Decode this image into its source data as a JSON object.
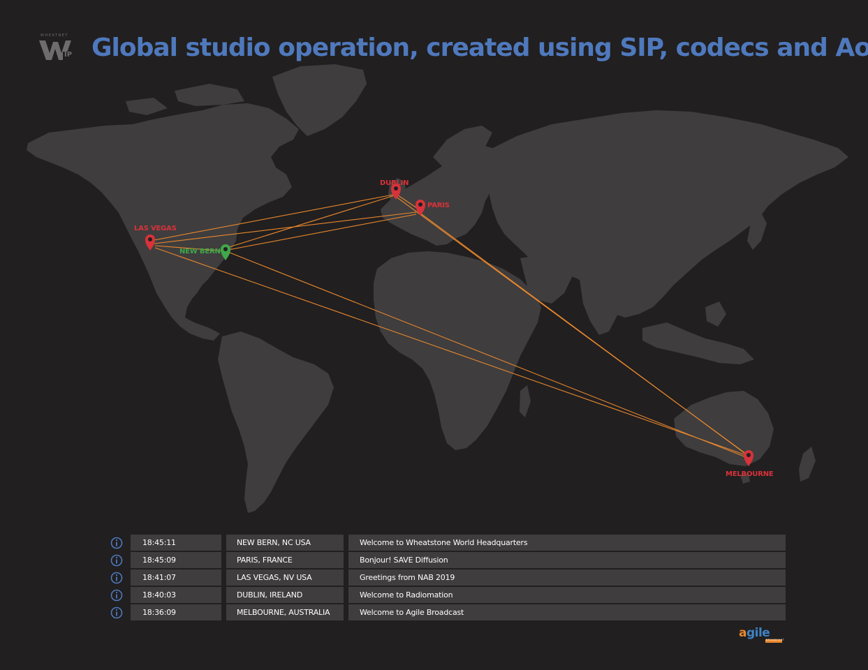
{
  "header": {
    "title": "Global studio operation, created using SIP, codecs and AoIP",
    "logo_small_text": "WHEATNET",
    "logo_text": "W",
    "logo_badge": "IP"
  },
  "map": {
    "line_color": "#e9882d",
    "land_color": "#3f3d3e",
    "ocean_color": "#211f20",
    "cities": [
      {
        "id": "dublin",
        "label": "DUBLIN",
        "color": "#d8323a"
      },
      {
        "id": "paris",
        "label": "PARIS",
        "color": "#d8323a"
      },
      {
        "id": "las-vegas",
        "label": "LAS VEGAS",
        "color": "#d8323a"
      },
      {
        "id": "new-bern",
        "label": "NEW BERN",
        "color": "#3fa84a"
      },
      {
        "id": "melbourne",
        "label": "MELBOURNE",
        "color": "#d8323a"
      }
    ]
  },
  "log": {
    "rows": [
      {
        "time": "18:45:11",
        "location": "NEW BERN, NC USA",
        "message": "Welcome to Wheatstone World Headquarters"
      },
      {
        "time": "18:45:09",
        "location": "PARIS, FRANCE",
        "message": "Bonjour! SAVE Diffusion"
      },
      {
        "time": "18:41:07",
        "location": "LAS VEGAS, NV USA",
        "message": "Greetings from NAB 2019"
      },
      {
        "time": "18:40:03",
        "location": "DUBLIN, IRELAND",
        "message": "Welcome to Radiomation"
      },
      {
        "time": "18:36:09",
        "location": "MELBOURNE, AUSTRALIA",
        "message": "Welcome to Agile Broadcast"
      }
    ],
    "icon": "info-circle-icon",
    "icon_color": "#4f79bd"
  },
  "footer": {
    "logo_lead": "a",
    "logo_text": "gile",
    "logo_sub": "BROADCAST"
  }
}
